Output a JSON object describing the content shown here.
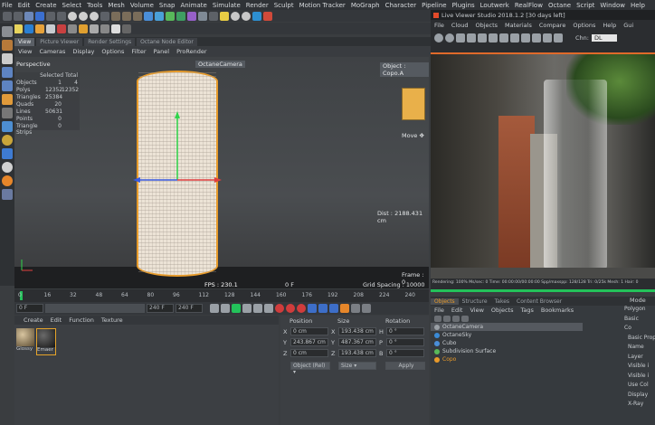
{
  "menu": [
    "File",
    "Edit",
    "Create",
    "Select",
    "Tools",
    "Mesh",
    "Volume",
    "Snap",
    "Animate",
    "Simulate",
    "Render",
    "Sculpt",
    "Motion Tracker",
    "MoGraph",
    "Character",
    "Pipeline",
    "Plugins",
    "Loutwerk",
    "RealFlow",
    "Octane",
    "Script",
    "Window",
    "Help"
  ],
  "viewport_tabs": [
    "View",
    "Picture Viewer",
    "Render Settings",
    "Octane Node Editor"
  ],
  "viewport_menu": [
    "View",
    "Cameras",
    "Display",
    "Options",
    "Filter",
    "Panel",
    "ProRender"
  ],
  "viewport": {
    "name": "Perspective",
    "camera": "OctaneCamera",
    "object_label": "Object : Copo.A",
    "stats_header": [
      "Selected Total"
    ],
    "stats": [
      [
        "Objects",
        "1",
        "4"
      ],
      [
        "Polys",
        "12352",
        "12352"
      ],
      [
        "Triangles",
        "25384",
        ""
      ],
      [
        "Quads",
        "20",
        ""
      ],
      [
        "Lines",
        "50631",
        ""
      ],
      [
        "Points",
        "0",
        ""
      ],
      [
        "Triangle Strips",
        "0",
        ""
      ]
    ],
    "move": "Move ✥",
    "dist": "Dist : 2188.431 cm",
    "frame": "Frame : 0",
    "fps": "FPS : 230.1",
    "current_frame": "0 F",
    "grid": "Grid Spacing : 10000 cm"
  },
  "timeline": {
    "ticks": [
      "0",
      "16",
      "32",
      "48",
      "64",
      "80",
      "96",
      "112",
      "128",
      "144",
      "160",
      "176",
      "192",
      "208",
      "224",
      "240"
    ],
    "start": "0 F",
    "end1": "240 F",
    "end2": "240 F"
  },
  "material_menu": [
    "Create",
    "Edit",
    "Function",
    "Texture"
  ],
  "materials": [
    "Glossy",
    "Emaer"
  ],
  "coords": {
    "headers": [
      "Position",
      "Size",
      "Rotation"
    ],
    "rows": [
      [
        "X",
        "0 cm",
        "X",
        "193.438 cm",
        "H",
        "0 °"
      ],
      [
        "Y",
        "243.867 cm",
        "Y",
        "487.367 cm",
        "P",
        "0 °"
      ],
      [
        "Z",
        "0 cm",
        "Z",
        "193.438 cm",
        "B",
        "0 °"
      ]
    ],
    "mode1": "Object (Rel) ▾",
    "mode2": "Size ▾",
    "apply": "Apply"
  },
  "live_viewer": {
    "title": "Live Viewer Studio 2018.1.2 [30 days left]",
    "menu": [
      "File",
      "Cloud",
      "Objects",
      "Materials",
      "Compare",
      "Options",
      "Help",
      "Gui"
    ],
    "channel": "Chn:",
    "channel_value": "DL",
    "status": "Rendering: 100%   Ms/sec: 0   Time: 00:00:00/00:00:00   Spp/maxspp: 128/128   Tri: 0/25k   Mesh: 1   Hair: 0"
  },
  "objects": {
    "tabs": [
      "Objects",
      "Structure",
      "Takes",
      "Content Browser"
    ],
    "menu": [
      "File",
      "Edit",
      "View",
      "Objects",
      "Tags",
      "Bookmarks"
    ],
    "items": [
      "OctaneCamera",
      "OctaneSky",
      "Cubo",
      "Subdivision Surface",
      "Copo"
    ]
  },
  "attributes": {
    "tabs": [
      "Mode"
    ],
    "items": [
      "Polygon",
      "Basic",
      "Co",
      "Basic Prope",
      "Name",
      "Layer",
      "Visible i",
      "Visible i",
      "Use Col",
      "Display",
      "X-Ray"
    ]
  },
  "colors": {
    "accent": "#e79b2b",
    "green": "#23c25a",
    "bg": "#3a3d40"
  }
}
